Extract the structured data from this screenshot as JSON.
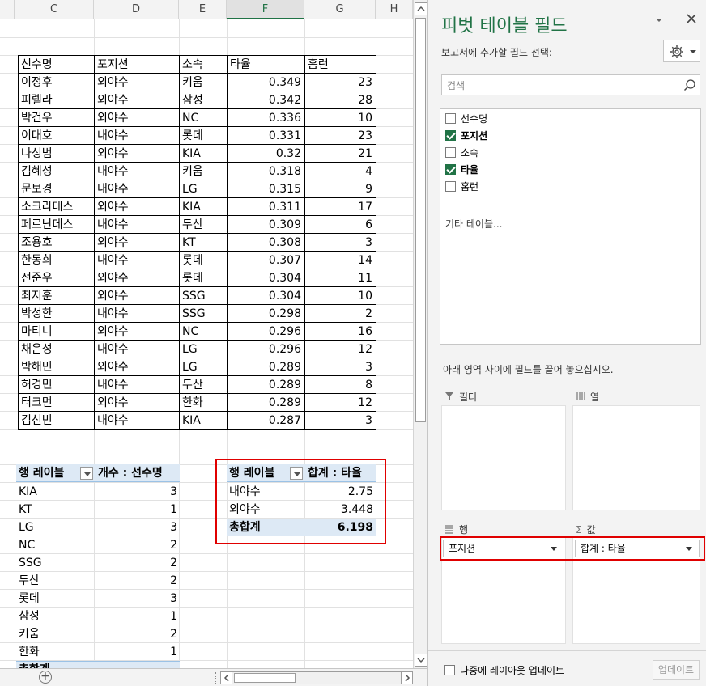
{
  "columns": [
    "C",
    "D",
    "E",
    "F",
    "G",
    "H"
  ],
  "data_table": {
    "headers": [
      "선수명",
      "포지션",
      "소속",
      "타율",
      "홈런"
    ],
    "rows": [
      [
        "이정후",
        "외야수",
        "키움",
        "0.349",
        "23"
      ],
      [
        "피렐라",
        "외야수",
        "삼성",
        "0.342",
        "28"
      ],
      [
        "박건우",
        "외야수",
        "NC",
        "0.336",
        "10"
      ],
      [
        "이대호",
        "내야수",
        "롯데",
        "0.331",
        "23"
      ],
      [
        "나성범",
        "외야수",
        "KIA",
        "0.32",
        "21"
      ],
      [
        "김혜성",
        "내야수",
        "키움",
        "0.318",
        "4"
      ],
      [
        "문보경",
        "내야수",
        "LG",
        "0.315",
        "9"
      ],
      [
        "소크라테스",
        "외야수",
        "KIA",
        "0.311",
        "17"
      ],
      [
        "페르난데스",
        "내야수",
        "두산",
        "0.309",
        "6"
      ],
      [
        "조용호",
        "외야수",
        "KT",
        "0.308",
        "3"
      ],
      [
        "한동희",
        "내야수",
        "롯데",
        "0.307",
        "14"
      ],
      [
        "전준우",
        "외야수",
        "롯데",
        "0.304",
        "11"
      ],
      [
        "최지훈",
        "외야수",
        "SSG",
        "0.304",
        "10"
      ],
      [
        "박성한",
        "내야수",
        "SSG",
        "0.298",
        "2"
      ],
      [
        "마티니",
        "외야수",
        "NC",
        "0.296",
        "16"
      ],
      [
        "채은성",
        "내야수",
        "LG",
        "0.296",
        "12"
      ],
      [
        "박해민",
        "외야수",
        "LG",
        "0.289",
        "3"
      ],
      [
        "허경민",
        "내야수",
        "두산",
        "0.289",
        "8"
      ],
      [
        "터크먼",
        "외야수",
        "한화",
        "0.289",
        "12"
      ],
      [
        "김선빈",
        "내야수",
        "KIA",
        "0.287",
        "3"
      ]
    ]
  },
  "pivot1": {
    "row_label": "행 레이블",
    "value_label": "개수 : 선수명",
    "rows": [
      [
        "KIA",
        "3"
      ],
      [
        "KT",
        "1"
      ],
      [
        "LG",
        "3"
      ],
      [
        "NC",
        "2"
      ],
      [
        "SSG",
        "2"
      ],
      [
        "두산",
        "2"
      ],
      [
        "롯데",
        "3"
      ],
      [
        "삼성",
        "1"
      ],
      [
        "키움",
        "2"
      ],
      [
        "한화",
        "1"
      ]
    ],
    "total_label": "총합계"
  },
  "pivot2": {
    "row_label": "행 레이블",
    "value_label": "합계 : 타율",
    "rows": [
      [
        "내야수",
        "2.75"
      ],
      [
        "외야수",
        "3.448"
      ]
    ],
    "total_label": "총합계",
    "total_value": "6.198"
  },
  "panel": {
    "title": "피벗 테이블 필드",
    "choose_label": "보고서에 추가할 필드 선택:",
    "search_placeholder": "검색",
    "fields": [
      {
        "name": "선수명",
        "checked": false
      },
      {
        "name": "포지션",
        "checked": true
      },
      {
        "name": "소속",
        "checked": false
      },
      {
        "name": "타율",
        "checked": true
      },
      {
        "name": "홈런",
        "checked": false
      }
    ],
    "more_tables": "기타 테이블...",
    "drag_hint": "아래 영역 사이에 필드를 끌어 놓으십시오.",
    "filter_label": "필터",
    "columns_label": "열",
    "rows_label": "행",
    "values_label": "값",
    "row_chip": "포지션",
    "value_chip": "합계 : 타율",
    "defer_label": "나중에 레이아웃 업데이트",
    "update_button": "업데이트"
  },
  "colors": {
    "accent": "#217346",
    "highlight": "#e00000",
    "pivot_header": "#dde9f5"
  }
}
